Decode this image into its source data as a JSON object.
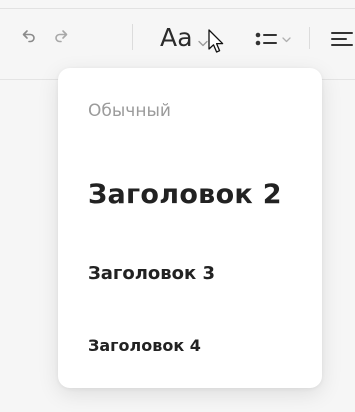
{
  "toolbar": {
    "undo_icon": "undo-icon",
    "redo_icon": "redo-icon",
    "text_style_label": "Aa",
    "list_icon": "bulleted-list-icon",
    "align_icon": "align-left-icon"
  },
  "text_style_menu": {
    "options": [
      {
        "label": "Обычный"
      },
      {
        "label": "Заголовок 2"
      },
      {
        "label": "Заголовок 3"
      },
      {
        "label": "Заголовок 4"
      }
    ]
  },
  "colors": {
    "background": "#f6f6f6",
    "menu_background": "#ffffff",
    "text": "#222222",
    "muted_text": "#9b9b9b",
    "icon": "#8a8a8a"
  }
}
